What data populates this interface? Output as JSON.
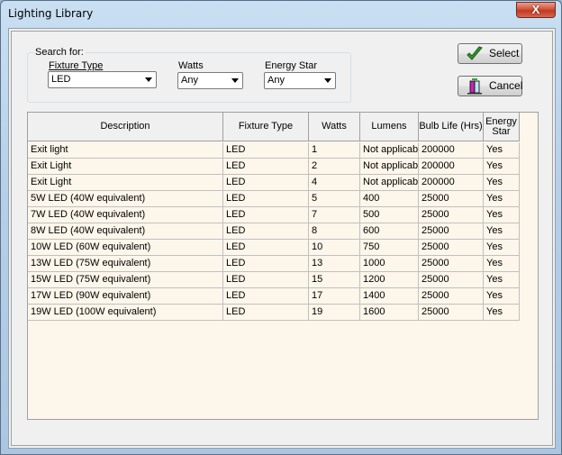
{
  "window": {
    "title": "Lighting Library",
    "close_label": "X"
  },
  "search": {
    "group_label": "Search for:",
    "fixture_type": {
      "label": "Fixture Type",
      "value": "LED"
    },
    "watts": {
      "label": "Watts",
      "value": "Any"
    },
    "energy_star": {
      "label": "Energy Star",
      "value": "Any"
    }
  },
  "buttons": {
    "select": "Select",
    "cancel": "Cancel"
  },
  "table": {
    "columns": [
      "Description",
      "Fixture Type",
      "Watts",
      "Lumens",
      "Bulb Life (Hrs)",
      "Energy Star"
    ],
    "rows": [
      [
        "Exit light",
        "LED",
        "1",
        "Not applicabl",
        "200000",
        "Yes"
      ],
      [
        "Exit Light",
        "LED",
        "2",
        "Not applicabl",
        "200000",
        "Yes"
      ],
      [
        "Exit Light",
        "LED",
        "4",
        "Not applicabl",
        "200000",
        "Yes"
      ],
      [
        "5W LED (40W equivalent)",
        "LED",
        "5",
        "400",
        "25000",
        "Yes"
      ],
      [
        "7W LED (40W equivalent)",
        "LED",
        "7",
        "500",
        "25000",
        "Yes"
      ],
      [
        "8W LED (40W equivalent)",
        "LED",
        "8",
        "600",
        "25000",
        "Yes"
      ],
      [
        "10W LED (60W equivalent)",
        "LED",
        "10",
        "750",
        "25000",
        "Yes"
      ],
      [
        "13W LED (75W equivalent)",
        "LED",
        "13",
        "1000",
        "25000",
        "Yes"
      ],
      [
        "15W LED (75W equivalent)",
        "LED",
        "15",
        "1200",
        "25000",
        "Yes"
      ],
      [
        "17W LED (90W equivalent)",
        "LED",
        "17",
        "1400",
        "25000",
        "Yes"
      ],
      [
        "19W LED (100W equivalent)",
        "LED",
        "19",
        "1600",
        "25000",
        "Yes"
      ]
    ]
  }
}
